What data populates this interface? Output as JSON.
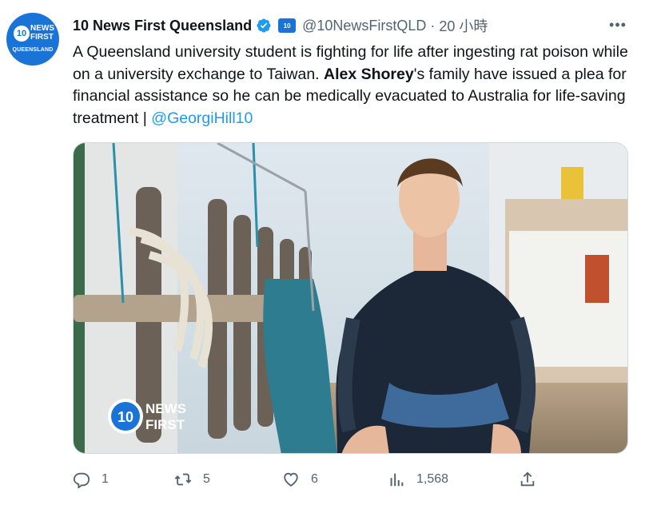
{
  "account": {
    "name": "10 News First Queensland",
    "handle": "@10NewsFirstQLD",
    "separator": "·",
    "time": "20 小時",
    "avatar": {
      "number": "10",
      "line1": "NEWS",
      "line2": "FIRST",
      "line3": "QUEENSLAND"
    },
    "org_badge": "10"
  },
  "more_label": "•••",
  "tweet": {
    "text_part1": "A Queensland university student is fighting for life after ingesting rat poison while on a university exchange to Taiwan. ",
    "bold_name": "Alex Shorey",
    "text_part2": "'s family have issued a plea for financial assistance so he can be medically evacuated to Australia for life-saving treatment | ",
    "mention": "@GeorgiHill10"
  },
  "media": {
    "watermark_num": "10",
    "watermark_line1": "NEWS",
    "watermark_line2": "FIRST"
  },
  "actions": {
    "reply_count": "1",
    "retweet_count": "5",
    "like_count": "6",
    "views_count": "1,568"
  },
  "colors": {
    "accent": "#1d9bf0",
    "secondary": "#536471",
    "brand": "#1a73d6"
  }
}
